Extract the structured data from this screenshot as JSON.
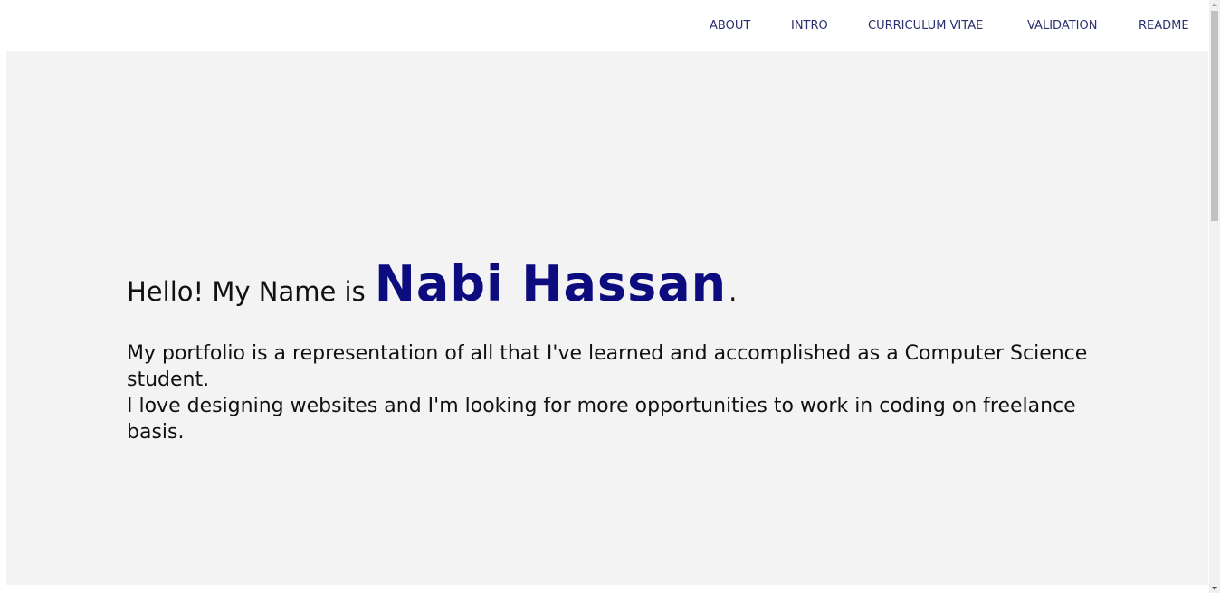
{
  "nav": {
    "items": [
      {
        "label": "ABOUT"
      },
      {
        "label": "INTRO"
      },
      {
        "label": "CURRICULUM VITAE"
      },
      {
        "label": "VALIDATION"
      },
      {
        "label": "README"
      }
    ]
  },
  "hero": {
    "greeting": "Hello! My Name is",
    "name": "Nabi  Hassan",
    "period": ".",
    "intro_line1": "My portfolio is a representation of all that I've learned and accomplished as a Computer Science student.",
    "intro_line2": "I love designing websites and I'm looking for more opportunities to work in coding on freelance basis."
  },
  "colors": {
    "name_color": "#0c0c7e",
    "nav_color": "#2b2f6e",
    "hero_background": "#f3f3f3"
  }
}
